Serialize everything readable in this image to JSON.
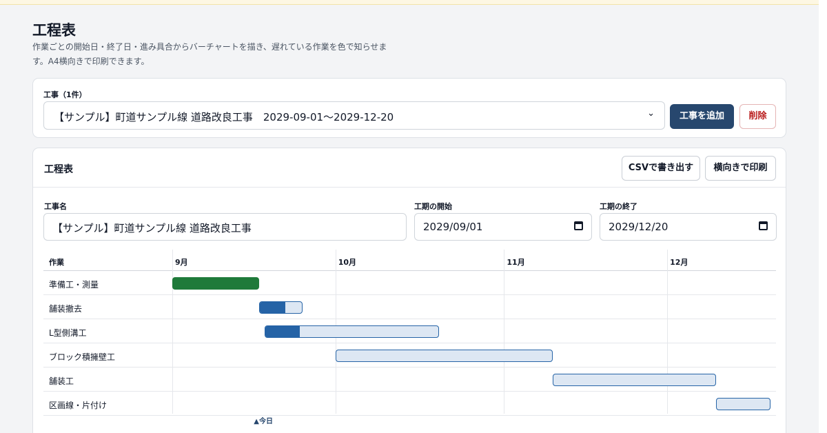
{
  "page": {
    "title": "工程表",
    "description": "作業ごとの開始日・終了日・進み具合からバーチャートを描き、遅れている作業を色で知らせます。A4横向きで印刷できます。"
  },
  "project_picker": {
    "label": "工事（1件）",
    "selected": "【サンプル】町道サンプル線 道路改良工事　2029-09-01〜2029-12-20",
    "add_label": "工事を追加",
    "delete_label": "削除"
  },
  "schedule": {
    "title": "工程表",
    "csv_label": "CSVで書き出す",
    "print_label": "横向きで印刷",
    "name_label": "工事名",
    "name_value": "【サンプル】町道サンプル線 道路改良工事",
    "start_label": "工期の開始",
    "start_value": "2029/09/01",
    "end_label": "工期の終了",
    "end_value": "2029/12/20"
  },
  "gantt": {
    "task_header": "作業",
    "months": [
      "9月",
      "10月",
      "11月",
      "12月"
    ],
    "today_label": "▲今日",
    "today": "2029-09-17",
    "tasks": [
      {
        "name": "準備工・測量",
        "start": "2029-09-01",
        "end": "2029-09-17",
        "progress": 1.0
      },
      {
        "name": "舗装撤去",
        "start": "2029-09-17",
        "end": "2029-09-25",
        "progress": 0.6
      },
      {
        "name": "L型側溝工",
        "start": "2029-09-18",
        "end": "2029-10-20",
        "progress": 0.2
      },
      {
        "name": "ブロック積擁壁工",
        "start": "2029-10-01",
        "end": "2029-11-10",
        "progress": 0
      },
      {
        "name": "舗装工",
        "start": "2029-11-10",
        "end": "2029-12-10",
        "progress": 0
      },
      {
        "name": "区画線・片付け",
        "start": "2029-12-10",
        "end": "2029-12-20",
        "progress": 0
      }
    ]
  },
  "colors": {
    "primary": "#27476e",
    "bar": "#2563a6",
    "bar_bg": "#dde7f3",
    "done": "#1f7a3a",
    "danger": "#b91c1c"
  }
}
